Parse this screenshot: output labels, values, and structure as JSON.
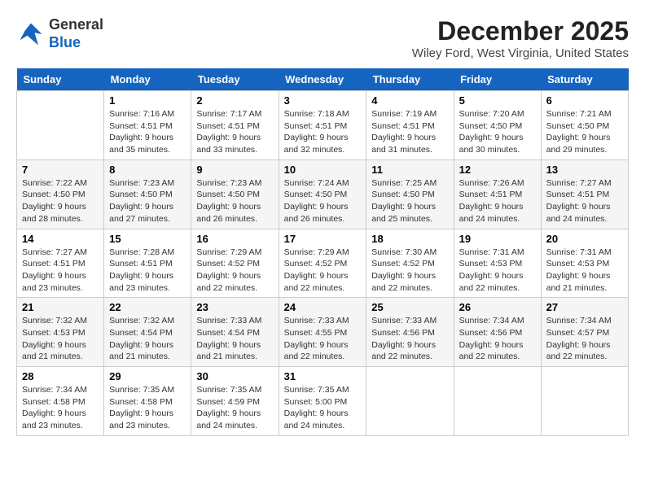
{
  "logo": {
    "line1": "General",
    "line2": "Blue"
  },
  "title": "December 2025",
  "location": "Wiley Ford, West Virginia, United States",
  "days_of_week": [
    "Sunday",
    "Monday",
    "Tuesday",
    "Wednesday",
    "Thursday",
    "Friday",
    "Saturday"
  ],
  "weeks": [
    [
      {
        "day": "",
        "info": ""
      },
      {
        "day": "1",
        "info": "Sunrise: 7:16 AM\nSunset: 4:51 PM\nDaylight: 9 hours\nand 35 minutes."
      },
      {
        "day": "2",
        "info": "Sunrise: 7:17 AM\nSunset: 4:51 PM\nDaylight: 9 hours\nand 33 minutes."
      },
      {
        "day": "3",
        "info": "Sunrise: 7:18 AM\nSunset: 4:51 PM\nDaylight: 9 hours\nand 32 minutes."
      },
      {
        "day": "4",
        "info": "Sunrise: 7:19 AM\nSunset: 4:51 PM\nDaylight: 9 hours\nand 31 minutes."
      },
      {
        "day": "5",
        "info": "Sunrise: 7:20 AM\nSunset: 4:50 PM\nDaylight: 9 hours\nand 30 minutes."
      },
      {
        "day": "6",
        "info": "Sunrise: 7:21 AM\nSunset: 4:50 PM\nDaylight: 9 hours\nand 29 minutes."
      }
    ],
    [
      {
        "day": "7",
        "info": "Sunrise: 7:22 AM\nSunset: 4:50 PM\nDaylight: 9 hours\nand 28 minutes."
      },
      {
        "day": "8",
        "info": "Sunrise: 7:23 AM\nSunset: 4:50 PM\nDaylight: 9 hours\nand 27 minutes."
      },
      {
        "day": "9",
        "info": "Sunrise: 7:23 AM\nSunset: 4:50 PM\nDaylight: 9 hours\nand 26 minutes."
      },
      {
        "day": "10",
        "info": "Sunrise: 7:24 AM\nSunset: 4:50 PM\nDaylight: 9 hours\nand 26 minutes."
      },
      {
        "day": "11",
        "info": "Sunrise: 7:25 AM\nSunset: 4:50 PM\nDaylight: 9 hours\nand 25 minutes."
      },
      {
        "day": "12",
        "info": "Sunrise: 7:26 AM\nSunset: 4:51 PM\nDaylight: 9 hours\nand 24 minutes."
      },
      {
        "day": "13",
        "info": "Sunrise: 7:27 AM\nSunset: 4:51 PM\nDaylight: 9 hours\nand 24 minutes."
      }
    ],
    [
      {
        "day": "14",
        "info": "Sunrise: 7:27 AM\nSunset: 4:51 PM\nDaylight: 9 hours\nand 23 minutes."
      },
      {
        "day": "15",
        "info": "Sunrise: 7:28 AM\nSunset: 4:51 PM\nDaylight: 9 hours\nand 23 minutes."
      },
      {
        "day": "16",
        "info": "Sunrise: 7:29 AM\nSunset: 4:52 PM\nDaylight: 9 hours\nand 22 minutes."
      },
      {
        "day": "17",
        "info": "Sunrise: 7:29 AM\nSunset: 4:52 PM\nDaylight: 9 hours\nand 22 minutes."
      },
      {
        "day": "18",
        "info": "Sunrise: 7:30 AM\nSunset: 4:52 PM\nDaylight: 9 hours\nand 22 minutes."
      },
      {
        "day": "19",
        "info": "Sunrise: 7:31 AM\nSunset: 4:53 PM\nDaylight: 9 hours\nand 22 minutes."
      },
      {
        "day": "20",
        "info": "Sunrise: 7:31 AM\nSunset: 4:53 PM\nDaylight: 9 hours\nand 21 minutes."
      }
    ],
    [
      {
        "day": "21",
        "info": "Sunrise: 7:32 AM\nSunset: 4:53 PM\nDaylight: 9 hours\nand 21 minutes."
      },
      {
        "day": "22",
        "info": "Sunrise: 7:32 AM\nSunset: 4:54 PM\nDaylight: 9 hours\nand 21 minutes."
      },
      {
        "day": "23",
        "info": "Sunrise: 7:33 AM\nSunset: 4:54 PM\nDaylight: 9 hours\nand 21 minutes."
      },
      {
        "day": "24",
        "info": "Sunrise: 7:33 AM\nSunset: 4:55 PM\nDaylight: 9 hours\nand 22 minutes."
      },
      {
        "day": "25",
        "info": "Sunrise: 7:33 AM\nSunset: 4:56 PM\nDaylight: 9 hours\nand 22 minutes."
      },
      {
        "day": "26",
        "info": "Sunrise: 7:34 AM\nSunset: 4:56 PM\nDaylight: 9 hours\nand 22 minutes."
      },
      {
        "day": "27",
        "info": "Sunrise: 7:34 AM\nSunset: 4:57 PM\nDaylight: 9 hours\nand 22 minutes."
      }
    ],
    [
      {
        "day": "28",
        "info": "Sunrise: 7:34 AM\nSunset: 4:58 PM\nDaylight: 9 hours\nand 23 minutes."
      },
      {
        "day": "29",
        "info": "Sunrise: 7:35 AM\nSunset: 4:58 PM\nDaylight: 9 hours\nand 23 minutes."
      },
      {
        "day": "30",
        "info": "Sunrise: 7:35 AM\nSunset: 4:59 PM\nDaylight: 9 hours\nand 24 minutes."
      },
      {
        "day": "31",
        "info": "Sunrise: 7:35 AM\nSunset: 5:00 PM\nDaylight: 9 hours\nand 24 minutes."
      },
      {
        "day": "",
        "info": ""
      },
      {
        "day": "",
        "info": ""
      },
      {
        "day": "",
        "info": ""
      }
    ]
  ]
}
